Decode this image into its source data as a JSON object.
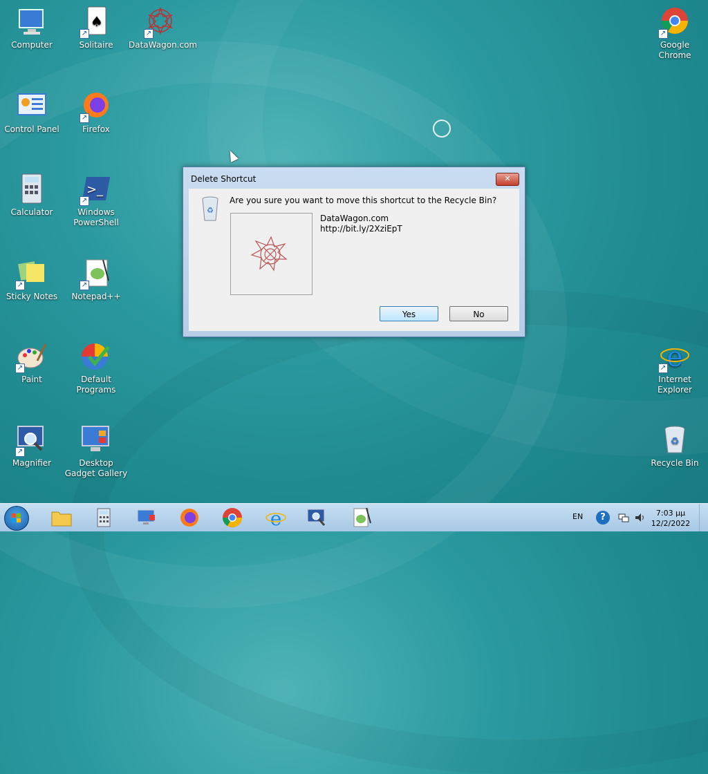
{
  "desktop": {
    "icons_left": [
      {
        "name": "computer",
        "label": "Computer",
        "glyph": "🖥"
      },
      {
        "name": "solitaire",
        "label": "Solitaire",
        "glyph": "🂡"
      },
      {
        "name": "datawagon",
        "label": "DataWagon.com",
        "glyph": "✺"
      },
      {
        "name": "control-panel",
        "label": "Control Panel",
        "glyph": "🗔"
      },
      {
        "name": "firefox",
        "label": "Firefox",
        "glyph": "🦊"
      },
      {
        "name": "calculator",
        "label": "Calculator",
        "glyph": "🖩"
      },
      {
        "name": "powershell",
        "label": "Windows PowerShell",
        "glyph": "❯"
      },
      {
        "name": "sticky-notes",
        "label": "Sticky Notes",
        "glyph": "🗒"
      },
      {
        "name": "notepad-plus-plus",
        "label": "Notepad++",
        "glyph": "📝"
      },
      {
        "name": "paint",
        "label": "Paint",
        "glyph": "🎨"
      },
      {
        "name": "default-programs",
        "label": "Default Programs",
        "glyph": "✔"
      },
      {
        "name": "magnifier",
        "label": "Magnifier",
        "glyph": "🔍"
      },
      {
        "name": "desktop-gadget-gallery",
        "label": "Desktop Gadget Gallery",
        "glyph": "▦"
      }
    ],
    "icons_right": [
      {
        "name": "google-chrome",
        "label": "Google Chrome",
        "glyph": "◉"
      },
      {
        "name": "internet-explorer",
        "label": "Internet Explorer",
        "glyph": "ℯ"
      },
      {
        "name": "recycle-bin",
        "label": "Recycle Bin",
        "glyph": "🗑"
      }
    ]
  },
  "dialog": {
    "title": "Delete Shortcut",
    "close_label": "✕",
    "message": "Are you sure you want to move this shortcut to the Recycle Bin?",
    "item_name": "DataWagon.com",
    "item_url": "http://bit.ly/2XziEpT",
    "yes_label": "Yes",
    "no_label": "No"
  },
  "taskbar": {
    "language": "EN",
    "help": "?",
    "time": "7:03 μμ",
    "date": "12/2/2022",
    "items": [
      "file-explorer",
      "calculator",
      "remote-desktop",
      "firefox",
      "chrome",
      "internet-explorer",
      "magnifier",
      "notepad-plus-plus"
    ]
  }
}
